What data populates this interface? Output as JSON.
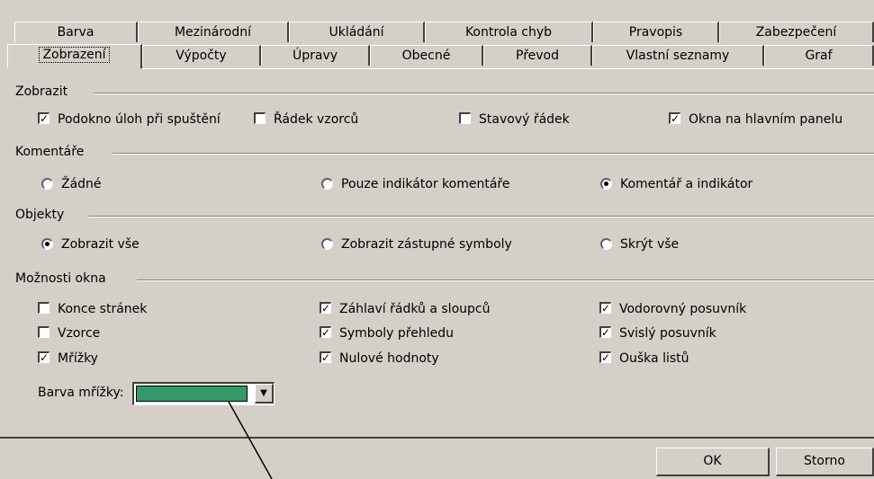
{
  "tabs_row1": [
    {
      "label": "Barva"
    },
    {
      "label": "Mezinárodní"
    },
    {
      "label": "Ukládání"
    },
    {
      "label": "Kontrola chyb"
    },
    {
      "label": "Pravopis"
    },
    {
      "label": "Zabezpečení"
    }
  ],
  "tabs_row2": [
    {
      "label": "Zobrazení"
    },
    {
      "label": "Výpočty"
    },
    {
      "label": "Úpravy"
    },
    {
      "label": "Obecné"
    },
    {
      "label": "Převod"
    },
    {
      "label": "Vlastní seznamy"
    },
    {
      "label": "Graf"
    }
  ],
  "show": {
    "title": "Zobrazit",
    "options": [
      {
        "label": "Podokno úloh při spuštění",
        "checked": true
      },
      {
        "label": "Řádek vzorců",
        "checked": false
      },
      {
        "label": "Stavový řádek",
        "checked": false
      },
      {
        "label": "Okna na hlavním panelu",
        "checked": true
      }
    ]
  },
  "comments": {
    "title": "Komentáře",
    "options": [
      {
        "label": "Žádné",
        "selected": false
      },
      {
        "label": "Pouze indikátor komentáře",
        "selected": false
      },
      {
        "label": "Komentář a indikátor",
        "selected": true
      }
    ]
  },
  "objects": {
    "title": "Objekty",
    "options": [
      {
        "label": "Zobrazit vše",
        "selected": true
      },
      {
        "label": "Zobrazit zástupné symboly",
        "selected": false
      },
      {
        "label": "Skrýt vše",
        "selected": false
      }
    ]
  },
  "window": {
    "title": "Možnosti okna",
    "options": [
      {
        "label": "Konce stránek",
        "checked": false
      },
      {
        "label": "Záhlaví řádků a sloupců",
        "checked": true
      },
      {
        "label": "Vodorovný posuvník",
        "checked": true
      },
      {
        "label": "Vzorce",
        "checked": false
      },
      {
        "label": "Symboly přehledu",
        "checked": true
      },
      {
        "label": "Svislý posuvník",
        "checked": true
      },
      {
        "label": "Mřížky",
        "checked": true
      },
      {
        "label": "Nulové hodnoty",
        "checked": true
      },
      {
        "label": "Ouška listů",
        "checked": true
      }
    ],
    "gridcolor_label": "Barva mřížky:",
    "gridcolor_value": "#339966"
  },
  "buttons": {
    "ok": "OK",
    "cancel": "Storno"
  },
  "icons": {
    "checkmark": "check-icon",
    "dropdown": "chevron-down-icon"
  }
}
